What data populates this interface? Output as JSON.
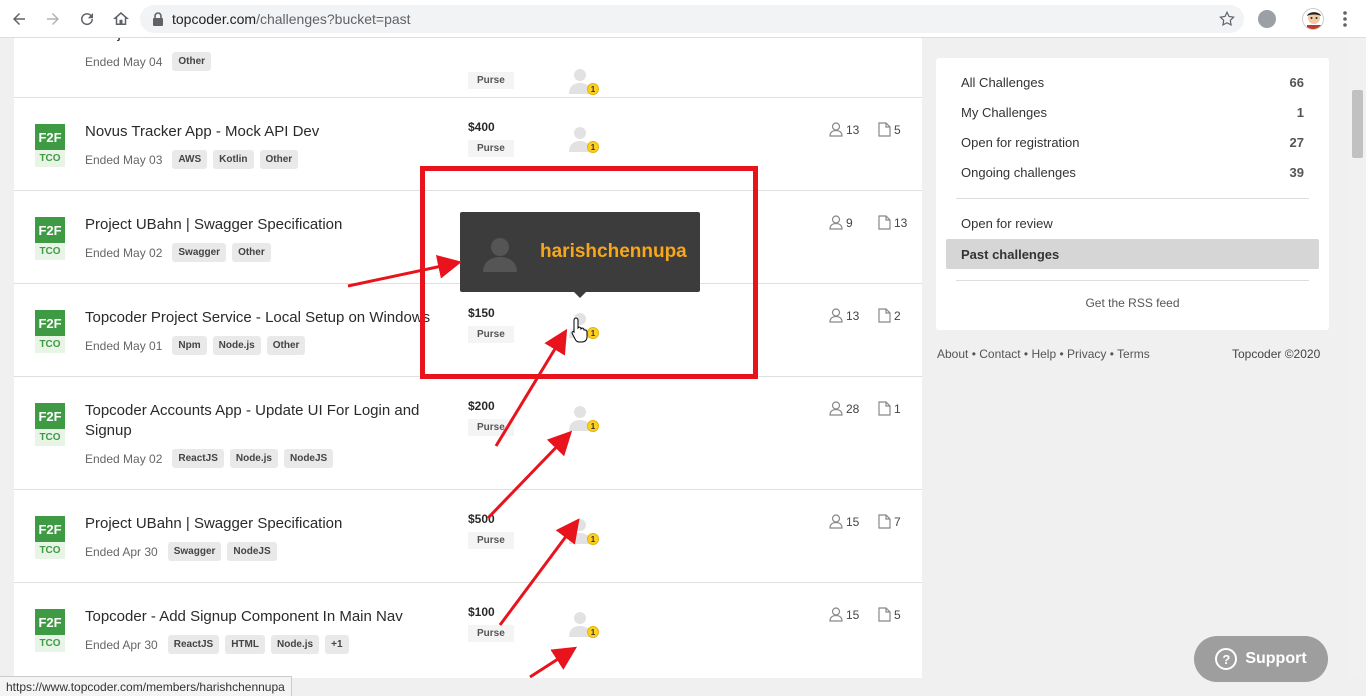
{
  "browser": {
    "url_host": "topcoder.com",
    "url_path": "/challenges?bucket=past",
    "status_url": "https://www.topcoder.com/members/harishchennupa"
  },
  "rows": [
    {
      "title": "codejam",
      "ended": "Ended May 04",
      "tags": [
        "Other"
      ],
      "prize": "",
      "purse": "Purse",
      "regs": "",
      "subs": ""
    },
    {
      "title": "Novus Tracker App - Mock API Dev",
      "ended": "Ended May 03",
      "tags": [
        "AWS",
        "Kotlin",
        "Other"
      ],
      "prize": "$400",
      "purse": "Purse",
      "regs": "13",
      "subs": "5"
    },
    {
      "title": "Project UBahn | Swagger Specification",
      "ended": "Ended May 02",
      "tags": [
        "Swagger",
        "Other"
      ],
      "prize": "",
      "purse": "",
      "regs": "9",
      "subs": "13"
    },
    {
      "title": "Topcoder Project Service - Local Setup on Windows",
      "ended": "Ended May 01",
      "tags": [
        "Npm",
        "Node.js",
        "Other"
      ],
      "prize": "$150",
      "purse": "Purse",
      "regs": "13",
      "subs": "2"
    },
    {
      "title": "Topcoder Accounts App - Update UI For Login and Signup",
      "ended": "Ended May 02",
      "tags": [
        "ReactJS",
        "Node.js",
        "NodeJS"
      ],
      "prize": "$200",
      "purse": "Purse",
      "regs": "28",
      "subs": "1"
    },
    {
      "title": "Project UBahn | Swagger Specification",
      "ended": "Ended Apr 30",
      "tags": [
        "Swagger",
        "NodeJS"
      ],
      "prize": "$500",
      "purse": "Purse",
      "regs": "15",
      "subs": "7"
    },
    {
      "title": "Topcoder - Add Signup Component In Main Nav",
      "ended": "Ended Apr 30",
      "tags": [
        "ReactJS",
        "HTML",
        "Node.js",
        "+1"
      ],
      "prize": "$100",
      "purse": "Purse",
      "regs": "15",
      "subs": "5"
    }
  ],
  "track": {
    "main": "F2F",
    "sub": "TCO"
  },
  "winner_badge": "1",
  "tooltip": {
    "handle": "harishchennupa"
  },
  "sidebar": {
    "items": [
      {
        "label": "All Challenges",
        "count": "66"
      },
      {
        "label": "My Challenges",
        "count": "1"
      },
      {
        "label": "Open for registration",
        "count": "27"
      },
      {
        "label": "Ongoing challenges",
        "count": "39"
      }
    ],
    "review": "Open for review",
    "past": "Past challenges",
    "rss": "Get the RSS feed"
  },
  "footer": {
    "about": "About",
    "contact": "Contact",
    "help": "Help",
    "privacy": "Privacy",
    "terms": "Terms",
    "copyright": "Topcoder ©2020"
  },
  "support": {
    "label": "Support"
  },
  "colors": {
    "accent": "#3e9b44",
    "annotation": "#e8131c",
    "handle": "#f6a71b"
  }
}
